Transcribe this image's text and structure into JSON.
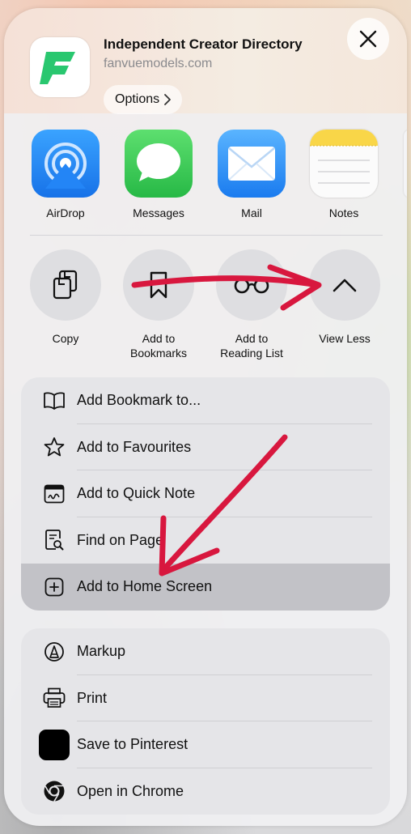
{
  "header": {
    "site_title": "Independent Creator Directory",
    "site_domain": "fanvuemodels.com",
    "options_label": "Options",
    "brand_color": "#29c76f"
  },
  "apps": [
    {
      "label": "AirDrop",
      "icon": "airdrop-icon"
    },
    {
      "label": "Messages",
      "icon": "messages-icon"
    },
    {
      "label": "Mail",
      "icon": "mail-icon"
    },
    {
      "label": "Notes",
      "icon": "notes-icon"
    }
  ],
  "actions": [
    {
      "label_line1": "Copy",
      "label_line2": "",
      "icon": "copy-icon"
    },
    {
      "label_line1": "Add to",
      "label_line2": "Bookmarks",
      "icon": "bookmark-icon"
    },
    {
      "label_line1": "Add to",
      "label_line2": "Reading List",
      "icon": "glasses-icon"
    },
    {
      "label_line1": "View Less",
      "label_line2": "",
      "icon": "chevron-up-icon"
    }
  ],
  "list1": [
    {
      "label": "Add Bookmark to...",
      "icon": "book-icon"
    },
    {
      "label": "Add to Favourites",
      "icon": "star-icon"
    },
    {
      "label": "Add to Quick Note",
      "icon": "quick-note-icon"
    },
    {
      "label": "Find on Page",
      "icon": "find-on-page-icon"
    },
    {
      "label": "Add to Home Screen",
      "icon": "add-square-icon",
      "highlighted": true
    }
  ],
  "list2": [
    {
      "label": "Markup",
      "icon": "markup-icon"
    },
    {
      "label": "Print",
      "icon": "print-icon"
    },
    {
      "label": "Save to Pinterest",
      "icon": "pinterest-icon"
    },
    {
      "label": "Open in Chrome",
      "icon": "chrome-icon"
    }
  ],
  "colors": {
    "annotation_arrow": "#d8173e",
    "airdrop_blue": "#1f8bff",
    "messages_green": "#35c759",
    "mail_blue": "#3a9cf5",
    "notes_yellow": "#f9d648",
    "highlight_row": "#c2c2c7"
  }
}
